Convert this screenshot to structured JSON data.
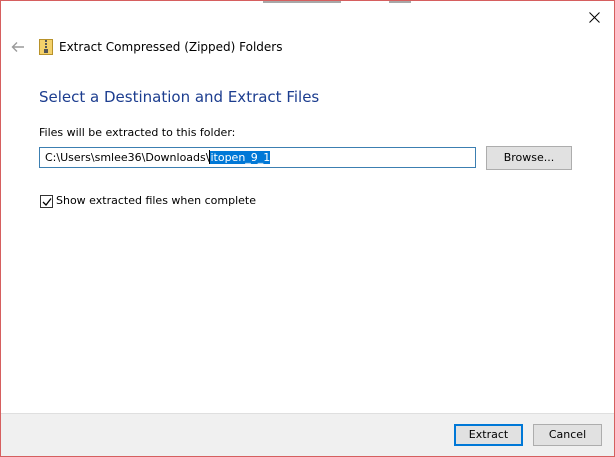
{
  "window": {
    "title": "Extract Compressed (Zipped) Folders"
  },
  "header": {
    "back_icon": "back-arrow-icon",
    "app_icon": "zip-folder-icon",
    "close_icon": "close-icon"
  },
  "main": {
    "heading": "Select a Destination and Extract Files",
    "folder_label": "Files will be extracted to this folder:",
    "path_prefix": "C:\\Users\\smlee36\\Downloads\\",
    "path_selected": "itopen_9_1",
    "browse_label": "Browse...",
    "show_files_label": "Show extracted files when complete",
    "show_files_checked": true
  },
  "footer": {
    "extract_label": "Extract",
    "cancel_label": "Cancel"
  },
  "colors": {
    "heading": "#1c3d8f",
    "accent": "#0078d7",
    "footer_bg": "#f0f0f0",
    "window_border": "#d65f5f"
  }
}
